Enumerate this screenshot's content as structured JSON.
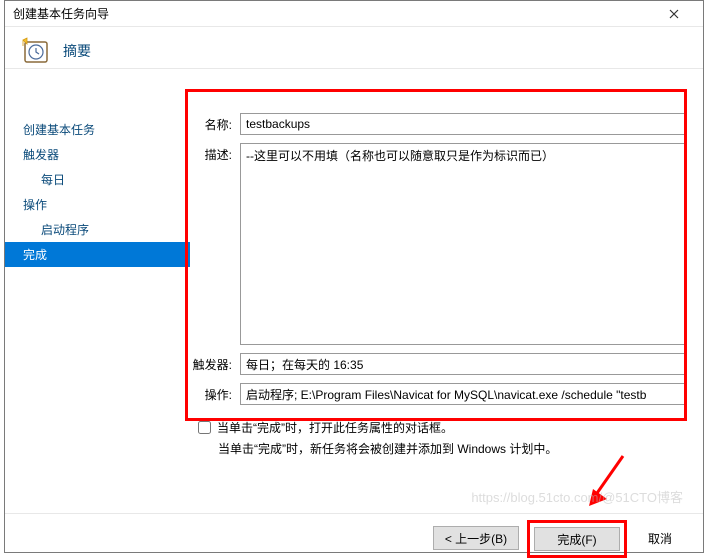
{
  "titlebar": {
    "title": "创建基本任务向导"
  },
  "header": {
    "title": "摘要"
  },
  "nav": {
    "items": [
      {
        "label": "创建基本任务",
        "sub": false,
        "selected": false
      },
      {
        "label": "触发器",
        "sub": false,
        "selected": false
      },
      {
        "label": "每日",
        "sub": true,
        "selected": false
      },
      {
        "label": "操作",
        "sub": false,
        "selected": false
      },
      {
        "label": "启动程序",
        "sub": true,
        "selected": false
      },
      {
        "label": "完成",
        "sub": false,
        "selected": true
      }
    ]
  },
  "form": {
    "name_label": "名称:",
    "name_value": "testbackups",
    "desc_label": "描述:",
    "desc_value": "--这里可以不用填（名称也可以随意取只是作为标识而已）",
    "trigger_label": "触发器:",
    "trigger_value": "每日；在每天的 16:35",
    "action_label": "操作:",
    "action_value": "启动程序; E:\\Program Files\\Navicat for MySQL\\navicat.exe /schedule \"testb"
  },
  "bottom": {
    "checkbox_label": "当单击“完成”时，打开此任务属性的对话框。",
    "info_text": "当单击“完成”时，新任务将会被创建并添加到 Windows 计划中。"
  },
  "buttons": {
    "back": "< 上一步(B)",
    "finish": "完成(F)",
    "cancel": "取消"
  },
  "watermark": "https://blog.51cto.com/@51CTO博客"
}
